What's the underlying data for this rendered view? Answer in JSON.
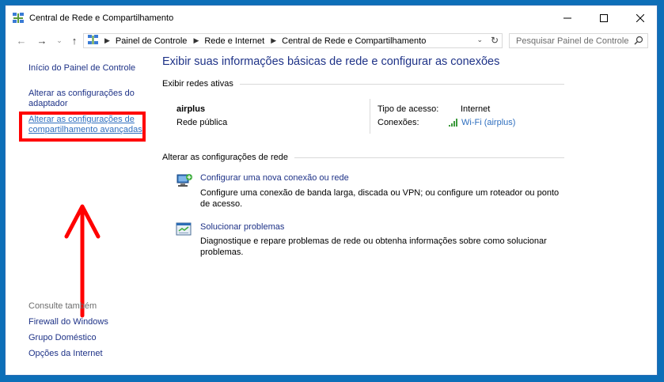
{
  "window": {
    "title": "Central de Rede e Compartilhamento"
  },
  "address": {
    "crumbs": [
      "Painel de Controle",
      "Rede e Internet",
      "Central de Rede e Compartilhamento"
    ],
    "search_placeholder": "Pesquisar Painel de Controle"
  },
  "left_pane": {
    "home": "Início do Painel de Controle",
    "adapter": "Alterar as configurações do adaptador",
    "sharing": "Alterar as configurações de compartilhamento avançadas",
    "see_also": "Consulte também",
    "see_also_links": [
      "Firewall do Windows",
      "Grupo Doméstico",
      "Opções da Internet"
    ]
  },
  "main": {
    "heading": "Exibir suas informações básicas de rede e configurar as conexões",
    "active_networks_header": "Exibir redes ativas",
    "network": {
      "name": "airplus",
      "type": "Rede pública",
      "access_label": "Tipo de acesso:",
      "access_value": "Internet",
      "connections_label": "Conexões:",
      "connection_link": "Wi-Fi (airplus)"
    },
    "change_settings_header": "Alterar as configurações de rede",
    "tasks": [
      {
        "title": "Configurar uma nova conexão ou rede",
        "desc": "Configure uma conexão de banda larga, discada ou VPN; ou configure um roteador ou ponto de acesso."
      },
      {
        "title": "Solucionar problemas",
        "desc": "Diagnostique e repare problemas de rede ou obtenha informações sobre como solucionar problemas."
      }
    ]
  },
  "colors": {
    "link": "#1e3287",
    "active_link": "#2f6fbf",
    "highlight": "#ff0000",
    "desktop": "#0d6fb8"
  },
  "icons": {
    "app": "network-center-icon",
    "back": "arrow-left-icon",
    "forward": "arrow-right-icon",
    "up": "arrow-up-icon",
    "search": "magnifier-icon",
    "refresh": "refresh-icon",
    "wifi": "wifi-signal-icon",
    "new_connection": "network-setup-icon",
    "troubleshoot": "troubleshoot-icon"
  }
}
